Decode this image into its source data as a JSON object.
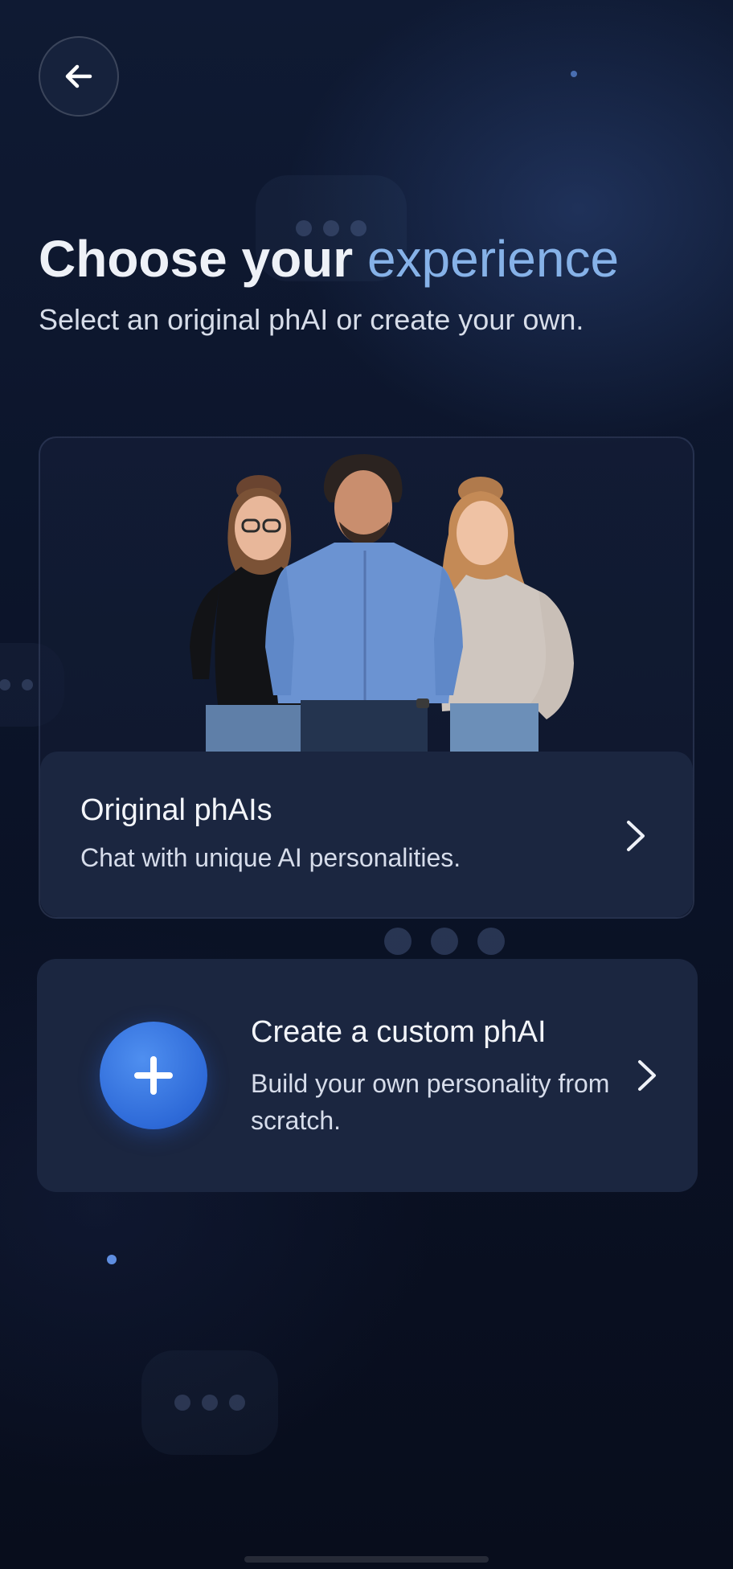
{
  "nav": {
    "back_icon": "arrow-left-icon"
  },
  "header": {
    "title_prefix": "Choose your",
    "title_accent": "experience",
    "subtitle": "Select an original phAI or create your own."
  },
  "original_card": {
    "image": "group-photo-three-people",
    "title": "Original phAIs",
    "description": "Chat with unique AI personalities.",
    "chevron_icon": "chevron-right-icon"
  },
  "pager": {
    "dots": 3
  },
  "custom_card": {
    "icon": "plus-icon",
    "title": "Create a custom phAI",
    "description": "Build your own personality from scratch.",
    "chevron_icon": "chevron-right-icon"
  },
  "colors": {
    "background": "#0c152b",
    "card": "#1b2640",
    "accent_text": "#86b2e8",
    "plus_button": "#2e6ad8"
  }
}
